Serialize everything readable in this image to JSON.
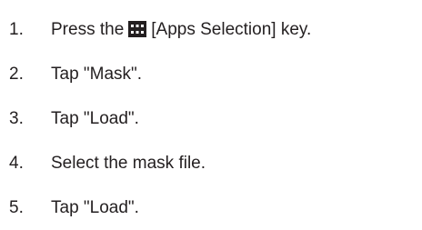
{
  "steps": [
    {
      "number": "1.",
      "text_before": "Press the",
      "icon": "apps-selection-key-icon",
      "text_after": "[Apps Selection] key."
    },
    {
      "number": "2.",
      "text": "Tap \"Mask\"."
    },
    {
      "number": "3.",
      "text": "Tap \"Load\"."
    },
    {
      "number": "4.",
      "text": "Select the mask file."
    },
    {
      "number": "5.",
      "text": "Tap \"Load\"."
    }
  ],
  "colors": {
    "text": "#231f20",
    "icon_fill": "#231f20",
    "background": "#ffffff"
  }
}
